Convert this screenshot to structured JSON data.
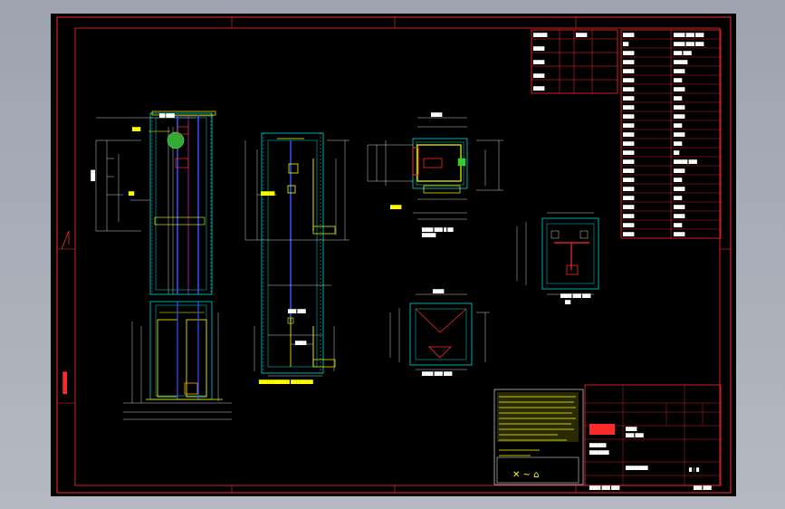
{
  "window": {
    "title": ""
  },
  "drawing": {
    "title_block_note": "",
    "views": [
      {
        "id": "elevation-left"
      },
      {
        "id": "elevation-middle"
      },
      {
        "id": "plan-top"
      },
      {
        "id": "plan-right"
      },
      {
        "id": "plan-bottom"
      }
    ],
    "colors": {
      "background": "#000000",
      "frame": "#ff2a2a",
      "cyan": "#00d8d8",
      "yellow": "#ffff00",
      "white": "#ffffff",
      "blue": "#3355ff",
      "green": "#33cc33",
      "magenta": "#ff33ff",
      "viewport": "#a7adb8"
    },
    "icons": [
      "elevator-shaft-drawing",
      "title-block",
      "parameter-table",
      "stamp"
    ]
  }
}
